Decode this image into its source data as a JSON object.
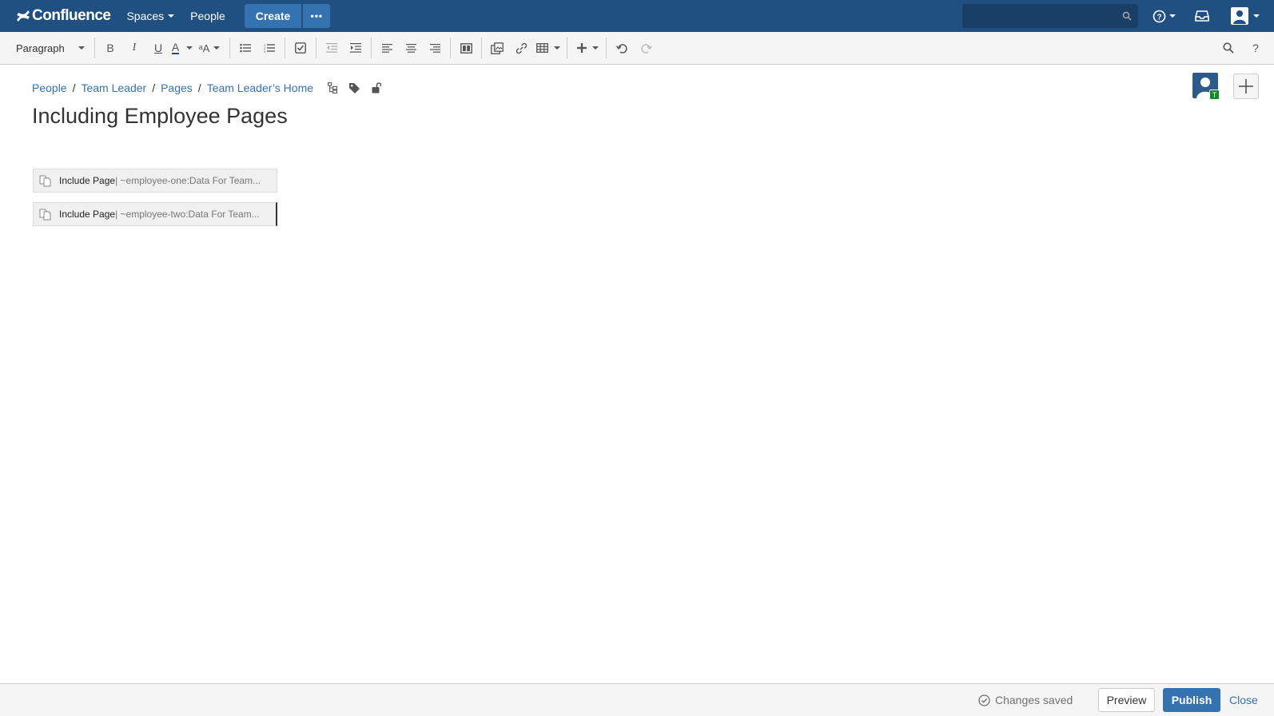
{
  "topnav": {
    "logo_text": "Confluence",
    "spaces_label": "Spaces",
    "people_label": "People",
    "create_label": "Create",
    "more_label": "•••",
    "search_placeholder": ""
  },
  "toolbar": {
    "paragraph_label": "Paragraph",
    "bold": "B",
    "italic": "I",
    "underline": "U",
    "text_color": "A",
    "formatting": "ᵃA",
    "help": "?"
  },
  "breadcrumb": {
    "items": [
      "People",
      "Team Leader",
      "Pages",
      "Team Leader’s Home"
    ],
    "separator": "/"
  },
  "page": {
    "title": "Including Employee Pages",
    "macros": [
      {
        "name": "Include Page",
        "param": " | ~employee-one:Data For Team..."
      },
      {
        "name": "Include Page",
        "param": " | ~employee-two:Data For Team..."
      }
    ]
  },
  "avatar": {
    "badge": "T"
  },
  "footer": {
    "status": "Changes saved",
    "preview_label": "Preview",
    "publish_label": "Publish",
    "close_label": "Close"
  },
  "colors": {
    "header": "#205081",
    "primary": "#3572b0",
    "link": "#3572b0",
    "badge": "#14892c"
  }
}
